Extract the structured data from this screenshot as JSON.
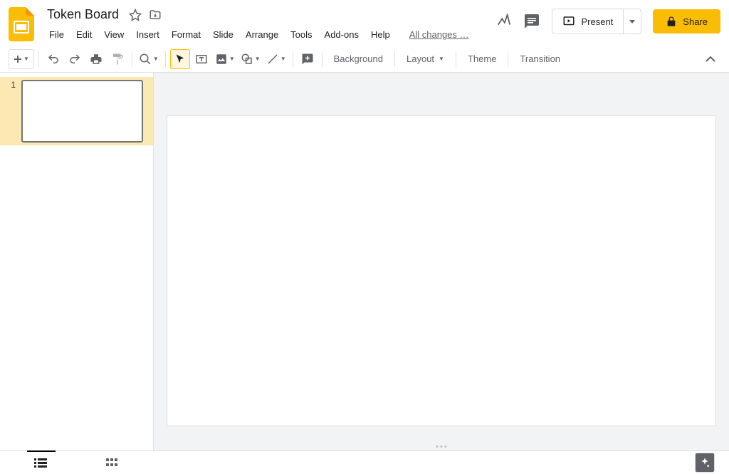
{
  "doc": {
    "title": "Token Board"
  },
  "menu": {
    "file": "File",
    "edit": "Edit",
    "view": "View",
    "insert": "Insert",
    "format": "Format",
    "slide": "Slide",
    "arrange": "Arrange",
    "tools": "Tools",
    "addons": "Add-ons",
    "help": "Help",
    "changes": "All changes …"
  },
  "header": {
    "present": "Present",
    "share": "Share"
  },
  "toolbar": {
    "background": "Background",
    "layout": "Layout",
    "theme": "Theme",
    "transition": "Transition"
  },
  "filmstrip": {
    "slides": [
      {
        "num": "1"
      }
    ]
  }
}
